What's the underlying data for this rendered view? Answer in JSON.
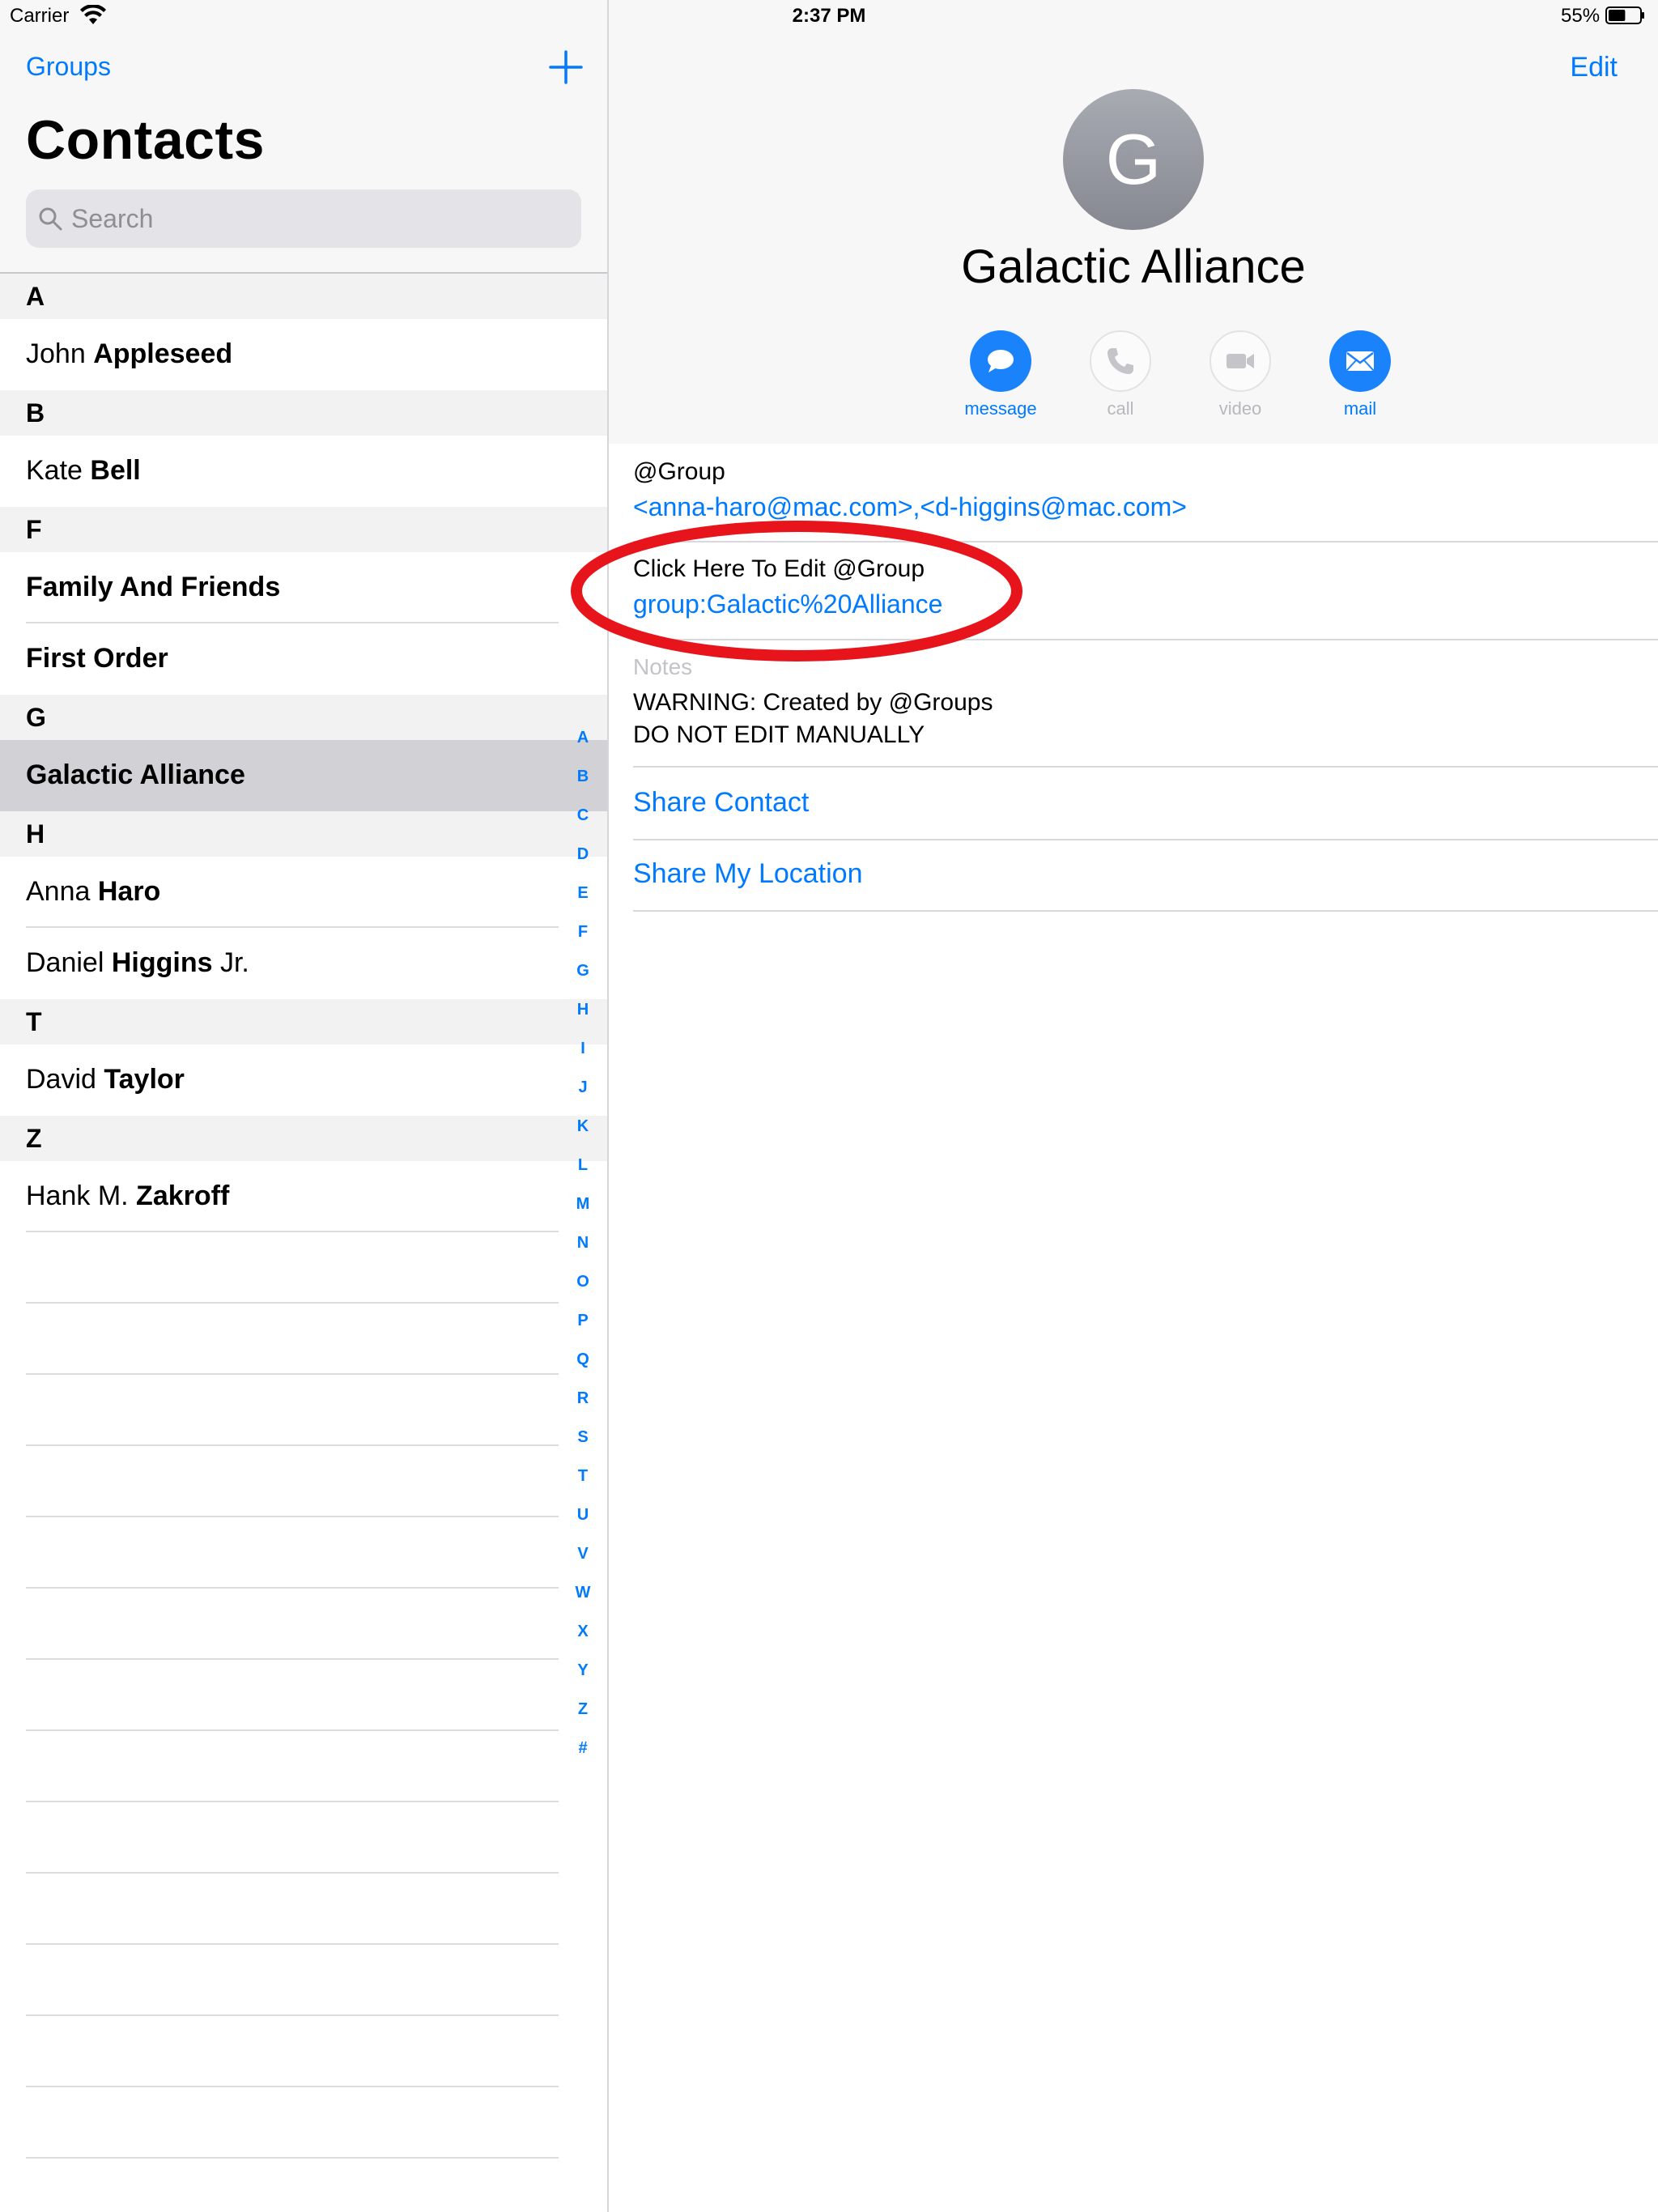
{
  "status_bar": {
    "carrier": "Carrier",
    "time": "2:37 PM",
    "battery": "55%",
    "battery_level": 0.55
  },
  "sidebar": {
    "groups_label": "Groups",
    "title": "Contacts",
    "search_placeholder": "Search",
    "sections": [
      {
        "letter": "A",
        "rows": [
          {
            "first": "John ",
            "last": "Appleseed",
            "suffix": ""
          }
        ]
      },
      {
        "letter": "B",
        "rows": [
          {
            "first": "Kate ",
            "last": "Bell",
            "suffix": ""
          }
        ]
      },
      {
        "letter": "F",
        "rows": [
          {
            "first": "",
            "last": "Family And Friends",
            "suffix": ""
          },
          {
            "first": "",
            "last": "First Order",
            "suffix": ""
          }
        ]
      },
      {
        "letter": "G",
        "rows": [
          {
            "first": "",
            "last": "Galactic Alliance",
            "suffix": "",
            "selected": true
          }
        ]
      },
      {
        "letter": "H",
        "rows": [
          {
            "first": "Anna ",
            "last": "Haro",
            "suffix": ""
          },
          {
            "first": "Daniel ",
            "last": "Higgins",
            "suffix": " Jr."
          }
        ]
      },
      {
        "letter": "T",
        "rows": [
          {
            "first": "David ",
            "last": "Taylor",
            "suffix": ""
          }
        ]
      },
      {
        "letter": "Z",
        "rows": [
          {
            "first": "Hank M. ",
            "last": "Zakroff",
            "suffix": ""
          }
        ]
      }
    ],
    "index_letters": [
      "A",
      "B",
      "C",
      "D",
      "E",
      "F",
      "G",
      "H",
      "I",
      "J",
      "K",
      "L",
      "M",
      "N",
      "O",
      "P",
      "Q",
      "R",
      "S",
      "T",
      "U",
      "V",
      "W",
      "X",
      "Y",
      "Z",
      "#"
    ]
  },
  "detail": {
    "edit_label": "Edit",
    "avatar_initial": "G",
    "name": "Galactic Alliance",
    "actions": [
      {
        "label": "message",
        "icon": "message-icon",
        "enabled": true
      },
      {
        "label": "call",
        "icon": "phone-icon",
        "enabled": false
      },
      {
        "label": "video",
        "icon": "video-icon",
        "enabled": false
      },
      {
        "label": "mail",
        "icon": "mail-icon",
        "enabled": true
      }
    ],
    "fields": [
      {
        "label": "@Group",
        "value": "<anna-haro@mac.com>,<d-higgins@mac.com>"
      },
      {
        "label": "Click Here To Edit @Group",
        "value": "group:Galactic%20Alliance"
      }
    ],
    "notes_label": "Notes",
    "notes_lines": [
      "WARNING: Created by @Groups",
      "DO NOT EDIT MANUALLY"
    ],
    "share_contact": "Share Contact",
    "share_location": "Share My Location"
  },
  "colors": {
    "accent": "#007aff",
    "highlight_ellipse": "#e8141b",
    "selected_row": "#d1d1d6"
  }
}
